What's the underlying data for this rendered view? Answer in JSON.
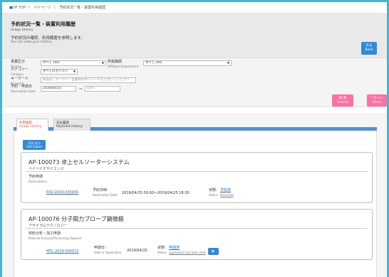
{
  "breadcrumb": {
    "items": [
      "■OF TOP",
      "マイページ",
      "予約状況一覧・装置利用履歴"
    ],
    "separator": "》"
  },
  "header": {
    "title": "予約状況一覧・装置利用履歴",
    "title_en": "Usage History",
    "description": "予約状況の確認、利用履歴を参照します。",
    "description_en": "You can view your history",
    "back_label": "戻る",
    "back_label_en": "Back"
  },
  "search": {
    "service_label": "事業区分",
    "service_label_en": "Service",
    "service_value": "すべて (All)",
    "dept_label": "所属機関",
    "dept_label_en": "Affiliated Department",
    "dept_value": "すべて (All)",
    "category_label": "カテゴリー",
    "category_label_en": "Category",
    "category_value": "すべてのカテゴリ",
    "keyword_label": "キーワード",
    "keyword_label_en": "Keywords",
    "keyword_placeholder": "商品名、メーカー、型番等のキーワードを入力してください",
    "date_label": "予約・申請日",
    "date_label_en": "Reservation Date",
    "date_from": "2019/04/25",
    "date_to_placeholder": "Until",
    "tilde": "〜",
    "search_label": "検 索",
    "search_label_en": "Search",
    "reset_label": "リセット",
    "reset_label_en": "Reset"
  },
  "tabs": [
    {
      "label": "利用履歴",
      "label_en": "Usage History",
      "active": true
    },
    {
      "label": "支払履歴",
      "label_en": "Payment History",
      "active": false
    }
  ],
  "csv_button": {
    "label": "CSV 出力",
    "label_en": "CSV Export"
  },
  "records": [
    {
      "title": "AP-100073 卓上セルソーターシステム",
      "subtitle": "ベイバイオサイエンス",
      "category": "予約申請",
      "category_en": "Reservations",
      "ref": "RSV-2019-030041",
      "date_label": "予約日時：",
      "date_label_en": "Reservation Date",
      "date_value": "2019/04/25 00:00〜2019/04/25 18:30",
      "status_label": "状態：",
      "status_label_en": "Status",
      "status_value": "予約済",
      "status_value_en": "Reserved"
    },
    {
      "title": "AP-100076 分子間力プローブ顕微鏡",
      "subtitle": "アサイラムテクノロジー",
      "category": "材料分析・加工申請",
      "category_en": "Material Analysis/Processing Request",
      "ref": "MTL-2019-000072",
      "date_label": "申請日：",
      "date_label_en": "Date of Application",
      "date_value": "2019/04/25",
      "status_label": "状態：",
      "status_label_en": "Status",
      "status_value": "申請済",
      "status_value_en": "application has been sent",
      "action_icon": "arrow-right-icon"
    }
  ],
  "colors": {
    "frame": "#4bb3c9",
    "accent_blue": "#2f8ad8",
    "accent_pink": "#ff6fa3",
    "tab_bar": "#4d90d6",
    "active_tab_text": "#e05a30",
    "link": "#2d6ca3"
  }
}
